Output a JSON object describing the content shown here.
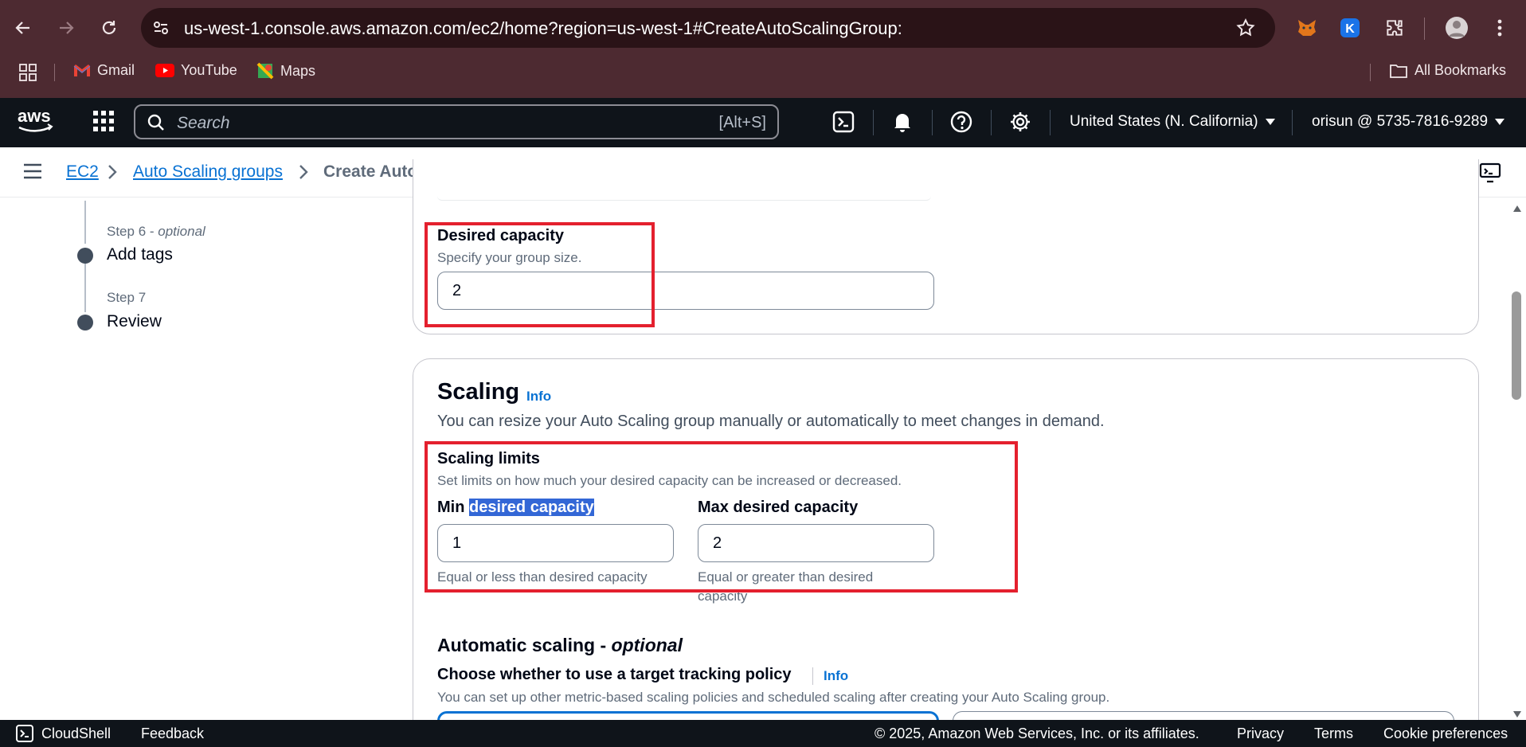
{
  "browser": {
    "url": "us-west-1.console.aws.amazon.com/ec2/home?region=us-west-1#CreateAutoScalingGroup:",
    "bookmarks": [
      {
        "label": "Gmail"
      },
      {
        "label": "YouTube"
      },
      {
        "label": "Maps"
      }
    ],
    "all_bookmarks": "All Bookmarks",
    "accent": "#4d2a31"
  },
  "aws_header": {
    "logo": "aws",
    "search_placeholder": "Search",
    "search_shortcut": "[Alt+S]",
    "region": "United States (N. California)",
    "account": "orisun @ 5735-7816-9289"
  },
  "breadcrumb": {
    "items": [
      {
        "label": "EC2"
      },
      {
        "label": "Auto Scaling groups"
      }
    ],
    "current": "Create Auto Scaling group"
  },
  "steps": [
    {
      "step": "Step 6 - ",
      "optional": "optional",
      "title": "Add tags"
    },
    {
      "step": "Step 7",
      "optional": "",
      "title": "Review"
    }
  ],
  "desired_capacity": {
    "label": "Desired capacity",
    "description": "Specify your group size.",
    "value": "2"
  },
  "scaling": {
    "title": "Scaling",
    "info": "Info",
    "description": "You can resize your Auto Scaling group manually or automatically to meet changes in demand.",
    "limits": {
      "label": "Scaling limits",
      "description": "Set limits on how much your desired capacity can be increased or decreased.",
      "min": {
        "label_prefix": "Min ",
        "label_highlight": "desired capacity",
        "value": "1",
        "hint": "Equal or less than desired capacity"
      },
      "max": {
        "label": "Max desired capacity",
        "value": "2",
        "hint_line1": "Equal or greater than desired",
        "hint_line2": "capacity"
      }
    },
    "automatic": {
      "title": "Automatic scaling - ",
      "optional": "optional",
      "question": "Choose whether to use a target tracking policy",
      "info": "Info",
      "description": "You can set up other metric-based scaling policies and scheduled scaling after creating your Auto Scaling group."
    }
  },
  "footer": {
    "cloudshell": "CloudShell",
    "feedback": "Feedback",
    "copyright": "© 2025, Amazon Web Services, Inc. or its affiliates.",
    "privacy": "Privacy",
    "terms": "Terms",
    "cookies": "Cookie preferences"
  }
}
